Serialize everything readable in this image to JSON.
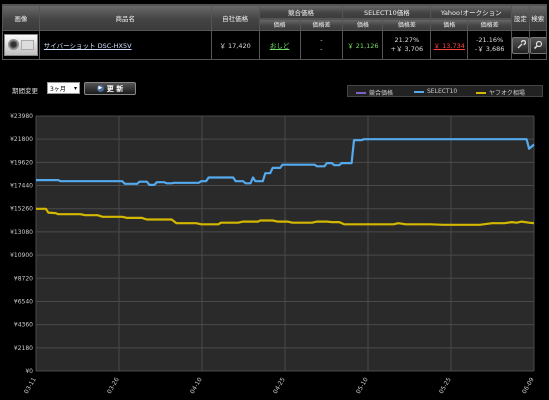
{
  "table": {
    "headers": {
      "image": "画像",
      "product_name": "商品名",
      "own_price": "自社価格",
      "competitor": "競合価格",
      "select10": "SELECT10価格",
      "yahoo": "Yahoo!オークション",
      "settings": "設定",
      "search": "検索"
    },
    "subheaders": {
      "price": "価格",
      "price_diff": "価格差"
    },
    "row": {
      "product": "サイバーショット DSC-HX5V",
      "own_price": "￥ 17,420",
      "competitor_price": "おしど",
      "competitor_diff_1": "-",
      "competitor_diff_2": "-",
      "select10_price": "￥ 21,126",
      "select10_diff_pct": "21.27%",
      "select10_diff_amt": "+￥ 3,706",
      "yahoo_price": "￥ 13,734",
      "yahoo_diff_pct": "-21.16%",
      "yahoo_diff_amt": "-￥ 3,686"
    }
  },
  "controls": {
    "period_label": "期間変更",
    "period_value": "3ヶ月",
    "update_label": "更 新"
  },
  "legend": [
    {
      "name": "競合価格",
      "color": "#7b61c8"
    },
    {
      "name": "SELECT10",
      "color": "#55aaee"
    },
    {
      "name": "ヤフオク相場",
      "color": "#d4b800"
    }
  ],
  "chart_data": {
    "type": "line",
    "ylim": [
      0,
      23980
    ],
    "yticks": [
      "¥23980",
      "¥21800",
      "¥19620",
      "¥17440",
      "¥15260",
      "¥13080",
      "¥10900",
      "¥8720",
      "¥6540",
      "¥4360",
      "¥2180",
      "¥0"
    ],
    "xticks": [
      "03-11",
      "03-26",
      "04-10",
      "04-25",
      "05-10",
      "05-25",
      "06-09"
    ],
    "n_points": 91,
    "series": [
      {
        "name": "SELECT10",
        "color": "#55aaee",
        "points": [
          [
            0,
            17950
          ],
          [
            9,
            17950
          ],
          [
            10,
            17850
          ],
          [
            35,
            17850
          ],
          [
            36,
            17600
          ],
          [
            41,
            17600
          ],
          [
            42,
            17800
          ],
          [
            45,
            17800
          ],
          [
            46,
            17500
          ],
          [
            48,
            17500
          ],
          [
            49,
            17750
          ],
          [
            52,
            17750
          ],
          [
            53,
            17650
          ],
          [
            55,
            17650
          ],
          [
            56,
            17700
          ],
          [
            66,
            17700
          ],
          [
            67,
            17850
          ],
          [
            69,
            17850
          ],
          [
            70,
            18200
          ],
          [
            80,
            18200
          ],
          [
            81,
            17850
          ],
          [
            84,
            17850
          ],
          [
            85,
            17650
          ],
          [
            87,
            17650
          ],
          [
            88,
            18200
          ],
          [
            89,
            17850
          ],
          [
            92,
            17850
          ],
          [
            93,
            18600
          ],
          [
            95,
            18600
          ],
          [
            96,
            19100
          ],
          [
            99,
            19100
          ],
          [
            100,
            19400
          ],
          [
            113,
            19400
          ],
          [
            114,
            19250
          ],
          [
            117,
            19250
          ],
          [
            118,
            19550
          ],
          [
            120,
            19550
          ],
          [
            121,
            19350
          ],
          [
            123,
            19350
          ],
          [
            124,
            19550
          ],
          [
            128,
            19550
          ],
          [
            129,
            21700
          ],
          [
            132,
            21700
          ],
          [
            133,
            21800
          ],
          [
            199,
            21800
          ],
          [
            200,
            20900
          ],
          [
            202,
            21300
          ]
        ]
      },
      {
        "name": "ヤフオク相場",
        "color": "#d4b800",
        "points": [
          [
            0,
            15250
          ],
          [
            4,
            15250
          ],
          [
            5,
            14900
          ],
          [
            8,
            14850
          ],
          [
            9,
            14750
          ],
          [
            18,
            14750
          ],
          [
            20,
            14650
          ],
          [
            25,
            14650
          ],
          [
            27,
            14500
          ],
          [
            35,
            14500
          ],
          [
            37,
            14400
          ],
          [
            43,
            14400
          ],
          [
            45,
            14250
          ],
          [
            55,
            14250
          ],
          [
            57,
            13900
          ],
          [
            65,
            13900
          ],
          [
            67,
            13800
          ],
          [
            74,
            13800
          ],
          [
            75,
            13950
          ],
          [
            82,
            13950
          ],
          [
            84,
            14050
          ],
          [
            90,
            14050
          ],
          [
            91,
            14150
          ],
          [
            96,
            14150
          ],
          [
            98,
            14050
          ],
          [
            102,
            14050
          ],
          [
            104,
            13950
          ],
          [
            112,
            13950
          ],
          [
            114,
            14050
          ],
          [
            118,
            14050
          ],
          [
            120,
            14000
          ],
          [
            123,
            14000
          ],
          [
            125,
            13800
          ],
          [
            130,
            13800
          ],
          [
            132,
            13800
          ],
          [
            145,
            13800
          ],
          [
            147,
            13900
          ],
          [
            150,
            13800
          ],
          [
            160,
            13800
          ],
          [
            165,
            13750
          ],
          [
            180,
            13750
          ],
          [
            185,
            13900
          ],
          [
            190,
            13900
          ],
          [
            193,
            14000
          ],
          [
            195,
            13950
          ],
          [
            197,
            14050
          ],
          [
            200,
            13950
          ],
          [
            202,
            13900
          ]
        ]
      }
    ],
    "x_domain": [
      0,
      202
    ]
  }
}
